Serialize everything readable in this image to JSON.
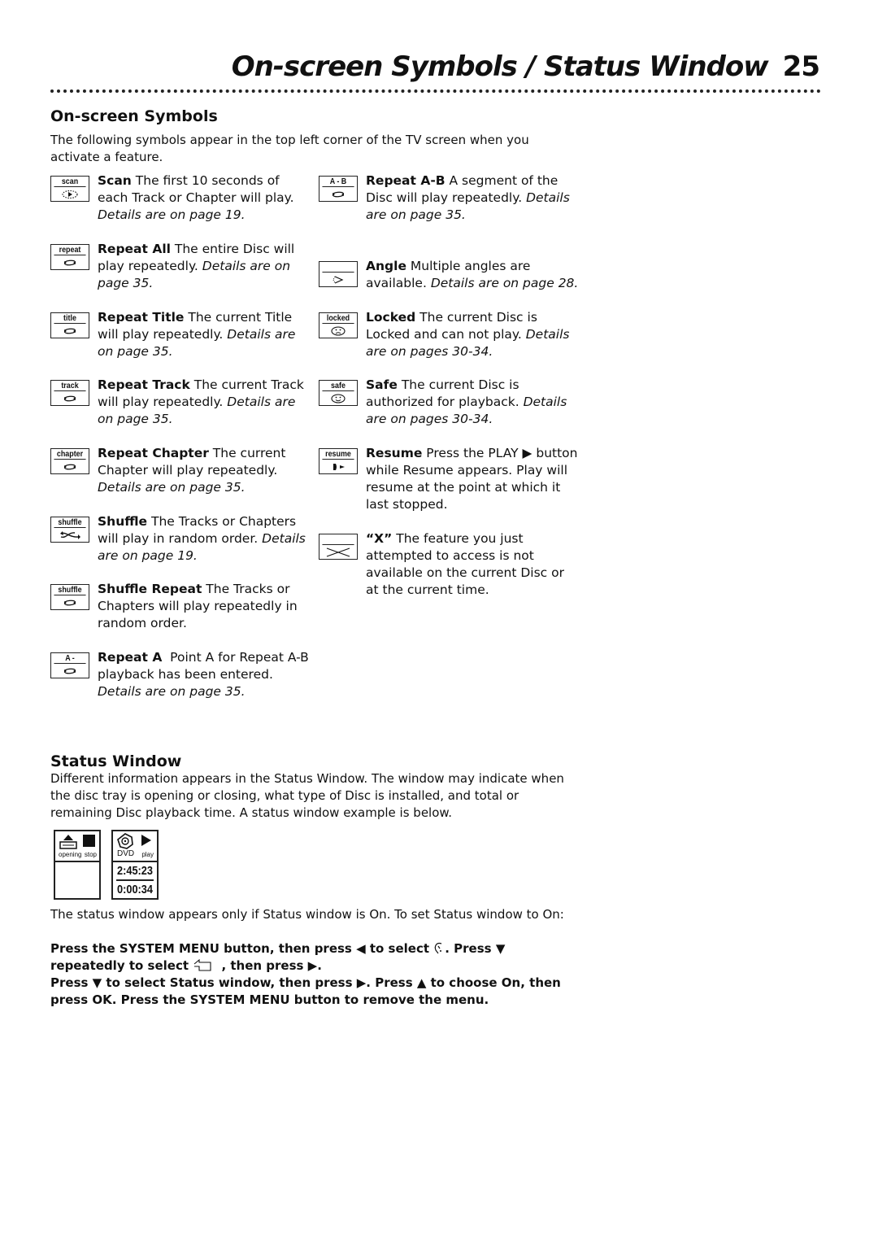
{
  "header": {
    "title": "On-screen Symbols / Status Window",
    "page_number": "25"
  },
  "onscreen_symbols": {
    "heading": "On-screen Symbols",
    "intro": "The following symbols appear in the top left corner of the TV screen when you activate a feature.",
    "left_column": [
      {
        "icon_label": "scan",
        "icon": "scan-play-icon",
        "title": "Scan",
        "text": " The first 10 seconds of each Track or Chapter will play. ",
        "details": "Details are on page 19."
      },
      {
        "icon_label": "repeat",
        "icon": "repeat-arrows-icon",
        "title": "Repeat All",
        "text": " The entire Disc will play repeatedly. ",
        "details": "Details are on page 35."
      },
      {
        "icon_label": "title",
        "icon": "repeat-arrows-icon",
        "title": "Repeat Title",
        "text": " The current Title will play repeatedly. ",
        "details": "Details are on page 35."
      },
      {
        "icon_label": "track",
        "icon": "repeat-arrows-icon",
        "title": "Repeat Track",
        "text": " The current Track will play repeatedly. ",
        "details": "Details are on page 35."
      },
      {
        "icon_label": "chapter",
        "icon": "repeat-arrows-icon",
        "title": "Repeat Chapter",
        "text": " The current Chapter will play repeatedly. ",
        "details": "Details are on page 35."
      },
      {
        "icon_label": "shuffle",
        "icon": "shuffle-arrows-icon",
        "title": "Shuffle",
        "text": " The Tracks or Chapters will play in random order. ",
        "details": "Details are on page 19."
      },
      {
        "icon_label": "shuffle",
        "icon": "repeat-arrows-icon",
        "title": "Shuffle Repeat",
        "text": " The Tracks or Chapters will play repeatedly in random order.",
        "details": ""
      },
      {
        "icon_label": "A -",
        "icon": "repeat-arrows-icon",
        "title": "Repeat A",
        "text": "  Point A for Repeat A-B playback has been entered. ",
        "details": "Details are on page 35."
      }
    ],
    "right_column": [
      {
        "icon_label": "A - B",
        "icon": "repeat-arrows-icon",
        "title": "Repeat A-B",
        "text": " A segment of the Disc will play repeatedly. ",
        "details": "Details are on page 35."
      },
      {
        "icon_label": "",
        "icon": "angle-icon",
        "title": "Angle",
        "text": " Multiple angles are available. ",
        "details": "Details are on page 28."
      },
      {
        "icon_label": "locked",
        "icon": "sad-face-icon",
        "title": "Locked",
        "text": " The current Disc is Locked and can not play. ",
        "details": "Details are on pages 30-34."
      },
      {
        "icon_label": "safe",
        "icon": "smiley-face-icon",
        "title": "Safe",
        "text": " The current Disc is authorized for playback. ",
        "details": "Details are on pages 30-34."
      },
      {
        "icon_label": "resume",
        "icon": "resume-icon",
        "title": "Resume",
        "text": " Press the PLAY ▶ button while Resume appears. Play will resume at the point at which it last stopped.",
        "details": ""
      },
      {
        "icon_label": "",
        "icon": "x-mark-icon",
        "title": "“X”",
        "text": " The feature you just attempted to access is not available on the current Disc or at the current time.",
        "details": ""
      }
    ]
  },
  "status_window": {
    "heading": "Status Window",
    "intro": "Different information appears in the Status Window. The window may indicate when the disc tray is opening or closing, what type of Disc is installed, and total or remaining Disc playback time. A status window example is below.",
    "example": {
      "tray_label": "opening",
      "stop_label": "stop",
      "disc_label": "DVD",
      "play_label": "play",
      "total_time": "2:45:23",
      "elapsed_time": "0:00:34"
    },
    "note": "The status window appears only if Status window is On. To set Status window to On:",
    "step1a": "Press the SYSTEM MENU button, then press ◀ to select ",
    "step1b": ". Press ▼ repeatedly to select ",
    "step1c": " , then press ▶.",
    "step2": "Press ▼ to select Status window, then press ▶. Press ▲ to choose On, then press OK. Press the SYSTEM MENU button to remove the menu."
  }
}
